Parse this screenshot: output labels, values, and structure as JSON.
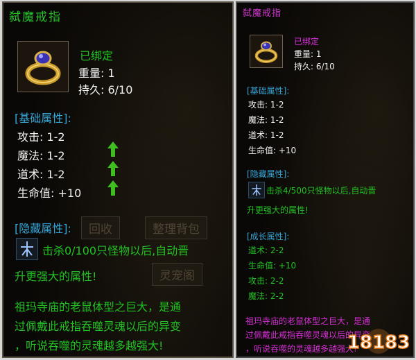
{
  "left": {
    "title": "弑魔戒指",
    "bound": "已绑定",
    "weight": "重量: 1",
    "durability": "持久: 6/10",
    "base_header": "[基础属性]:",
    "base_stats": [
      "攻击: 1-2",
      "魔法: 1-2",
      "道术: 1-2",
      "生命值: +10"
    ],
    "hidden_header": "[隐藏属性]:",
    "hidden_line1": "击杀0/100只怪物以后,自动晋",
    "hidden_line2": "升更强大的属性!",
    "ghost_buttons": [
      "回收",
      "整理背包",
      "灵宠阁"
    ],
    "desc": [
      "祖玛寺庙的老鼠体型之巨大，是通",
      "过佩戴此戒指吞噬灵魂以后的异变",
      "，听说吞噬的灵魂越多越强大!"
    ]
  },
  "right": {
    "title": "弑魔戒指",
    "bound": "已绑定",
    "weight": "重量: 1",
    "durability": "持久: 6/10",
    "base_header": "[基础属性]:",
    "base_stats": [
      "攻击: 1-2",
      "魔法: 1-2",
      "道术: 1-2",
      "生命值: +10"
    ],
    "hidden_header": "[隐藏属性]:",
    "hidden_line1": "击杀4/500只怪物以后,自动晋",
    "hidden_line2": "升更强大的属性!",
    "growth_header": "[成长属性]:",
    "growth_stats": [
      "道术: 2-2",
      "生命值: +10",
      "攻击: 2-2",
      "魔法: 2-2"
    ],
    "desc": [
      "祖玛寺庙的老鼠体型之巨大，是通",
      "过佩戴此戒指吞噬灵魂以后的异变",
      "，听说吞噬的灵魂越多越强大!"
    ]
  },
  "watermark": "18183",
  "colors": {
    "green": "#22c124",
    "cyan": "#35a6d7",
    "magenta": "#d62fd6",
    "white": "#f2f2f2"
  }
}
